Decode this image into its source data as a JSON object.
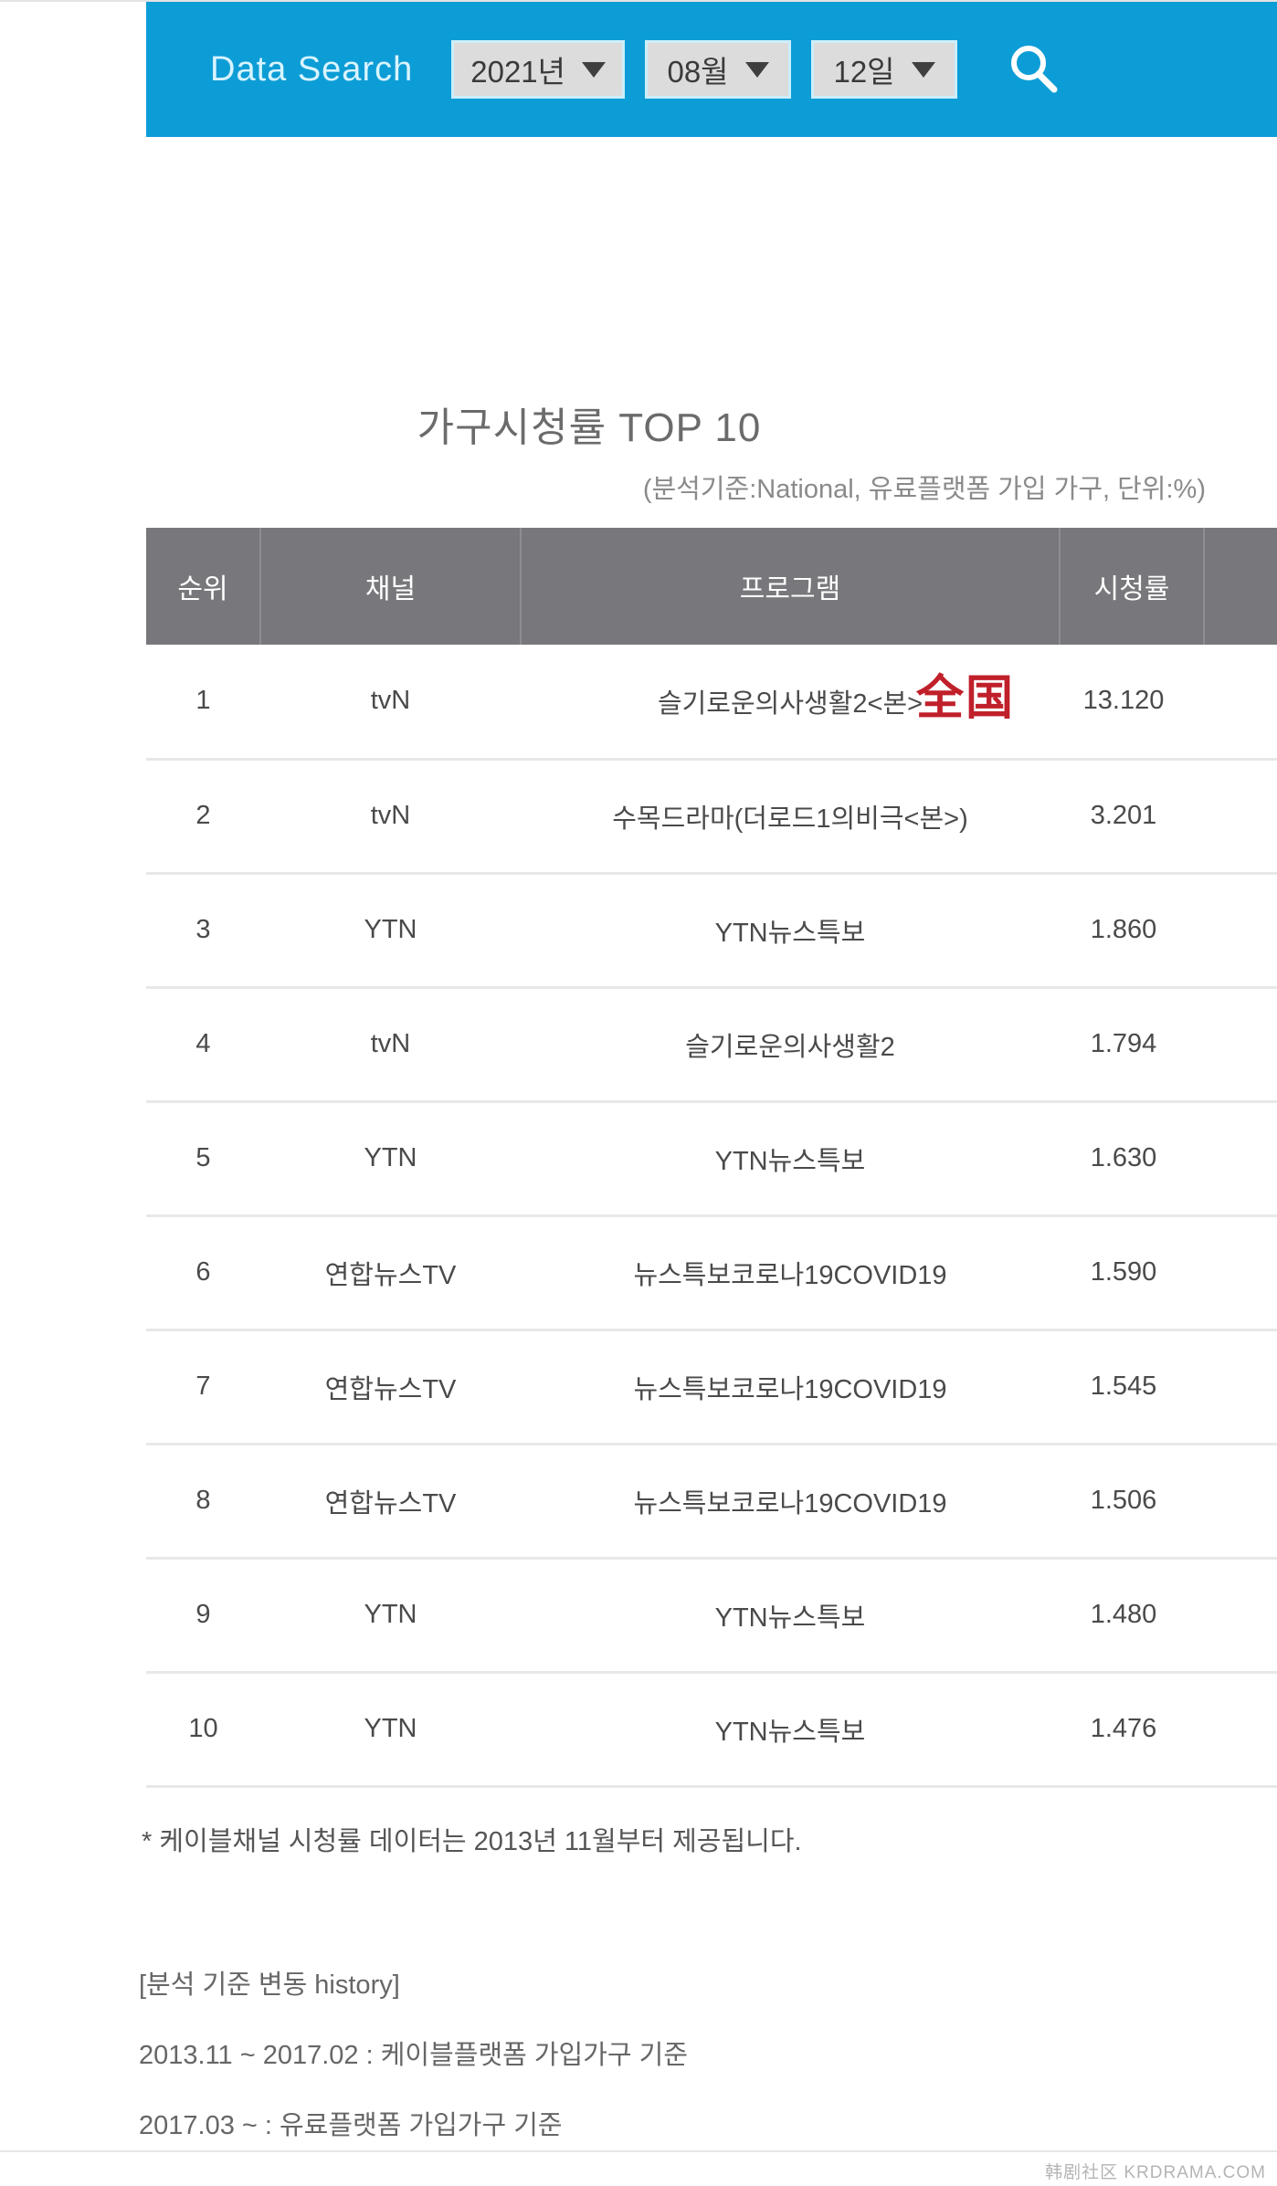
{
  "search": {
    "title": "Data Search",
    "year": {
      "value": "2021년",
      "caret": "chevron-down-icon"
    },
    "month": {
      "value": "08월",
      "caret": "chevron-down-icon"
    },
    "day": {
      "value": "12일",
      "caret": "chevron-down-icon"
    },
    "search_icon": "search-icon",
    "bar_color": "#0d9dd6"
  },
  "report": {
    "title": "가구시청률 TOP 10",
    "subtitle": "(분석기준:National, 유료플랫폼 가입 가구, 단위:%)",
    "stamp": "全国",
    "stamp_color": "#c0202a",
    "value_color": "#169bd5",
    "header_bg": "#78787c"
  },
  "table": {
    "headers": [
      "순위",
      "채널",
      "프로그램",
      "시청률",
      ""
    ],
    "rows": [
      {
        "rank": "1",
        "channel": "tvN",
        "program": "슬기로운의사생활2<본>",
        "rate": "13.120"
      },
      {
        "rank": "2",
        "channel": "tvN",
        "program": "수목드라마(더로드1의비극<본>)",
        "rate": "3.201"
      },
      {
        "rank": "3",
        "channel": "YTN",
        "program": "YTN뉴스특보",
        "rate": "1.860"
      },
      {
        "rank": "4",
        "channel": "tvN",
        "program": "슬기로운의사생활2",
        "rate": "1.794"
      },
      {
        "rank": "5",
        "channel": "YTN",
        "program": "YTN뉴스특보",
        "rate": "1.630"
      },
      {
        "rank": "6",
        "channel": "연합뉴스TV",
        "program": "뉴스특보코로나19COVID19",
        "rate": "1.590"
      },
      {
        "rank": "7",
        "channel": "연합뉴스TV",
        "program": "뉴스특보코로나19COVID19",
        "rate": "1.545"
      },
      {
        "rank": "8",
        "channel": "연합뉴스TV",
        "program": "뉴스특보코로나19COVID19",
        "rate": "1.506"
      },
      {
        "rank": "9",
        "channel": "YTN",
        "program": "YTN뉴스특보",
        "rate": "1.480"
      },
      {
        "rank": "10",
        "channel": "YTN",
        "program": "YTN뉴스특보",
        "rate": "1.476"
      }
    ]
  },
  "notes": {
    "footnote": "* 케이블채널 시청률 데이터는 2013년 11월부터 제공됩니다.",
    "history_title": "[분석 기준 변동 history]",
    "history_1": "2013.11 ~ 2017.02 : 케이블플랫폼 가입가구 기준",
    "history_2": "2017.03 ~ : 유료플랫폼 가입가구 기준"
  },
  "watermark": "韩剧社区 KRDRAMA.COM",
  "chart_data": {
    "type": "table",
    "title": "가구시청률 TOP 10",
    "subtitle": "(분석기준:National, 유료플랫폼 가입 가구, 단위:%)",
    "columns": [
      "순위",
      "채널",
      "프로그램",
      "시청률"
    ],
    "categories": [
      "슬기로운의사생활2<본>",
      "수목드라마(더로드1의비극<본>)",
      "YTN뉴스특보",
      "슬기로운의사생활2",
      "YTN뉴스특보",
      "뉴스특보코로나19COVID19",
      "뉴스특보코로나19COVID19",
      "뉴스특보코로나19COVID19",
      "YTN뉴스특보",
      "YTN뉴스특보"
    ],
    "values": [
      13.12,
      3.201,
      1.86,
      1.794,
      1.63,
      1.59,
      1.545,
      1.506,
      1.48,
      1.476
    ],
    "channels": [
      "tvN",
      "tvN",
      "YTN",
      "tvN",
      "YTN",
      "연합뉴스TV",
      "연합뉴스TV",
      "연합뉴스TV",
      "YTN",
      "YTN"
    ],
    "ranks": [
      1,
      2,
      3,
      4,
      5,
      6,
      7,
      8,
      9,
      10
    ],
    "ylabel": "시청률 (%)",
    "date": "2021년 08월 12일"
  }
}
